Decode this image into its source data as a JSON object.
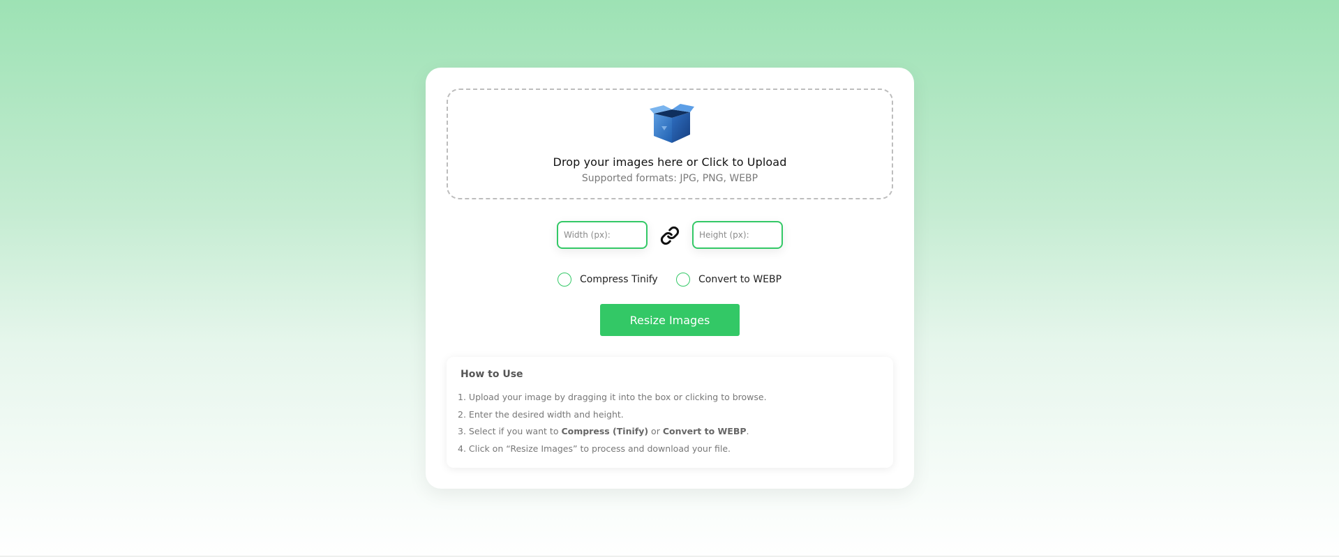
{
  "upload": {
    "title": "Drop your images here or Click to Upload",
    "formats": "Supported formats: JPG, PNG, WEBP",
    "icon": "open-box-icon"
  },
  "dimensions": {
    "width_placeholder": "Width (px):",
    "height_placeholder": "Height (px):",
    "width_value": "",
    "height_value": "",
    "link_icon": "chain-link-icon"
  },
  "options": {
    "compress_label": "Compress Tinify",
    "webp_label": "Convert to WEBP"
  },
  "action": {
    "resize_label": "Resize Images"
  },
  "howto": {
    "title": "How to Use",
    "steps": [
      {
        "num": "1.",
        "text": "Upload your image by dragging it into the box or clicking to browse."
      },
      {
        "num": "2.",
        "text": "Enter the desired width and height."
      },
      {
        "num": "3.",
        "pre": "Select if you want to ",
        "bold1": "Compress (Tinify)",
        "mid": " or ",
        "bold2": "Convert to WEBP",
        "post": "."
      },
      {
        "num": "4.",
        "text": "Click on “Resize Images” to process and download your file."
      }
    ]
  },
  "colors": {
    "accent": "#33c866",
    "bg_top": "#9de2b4"
  }
}
